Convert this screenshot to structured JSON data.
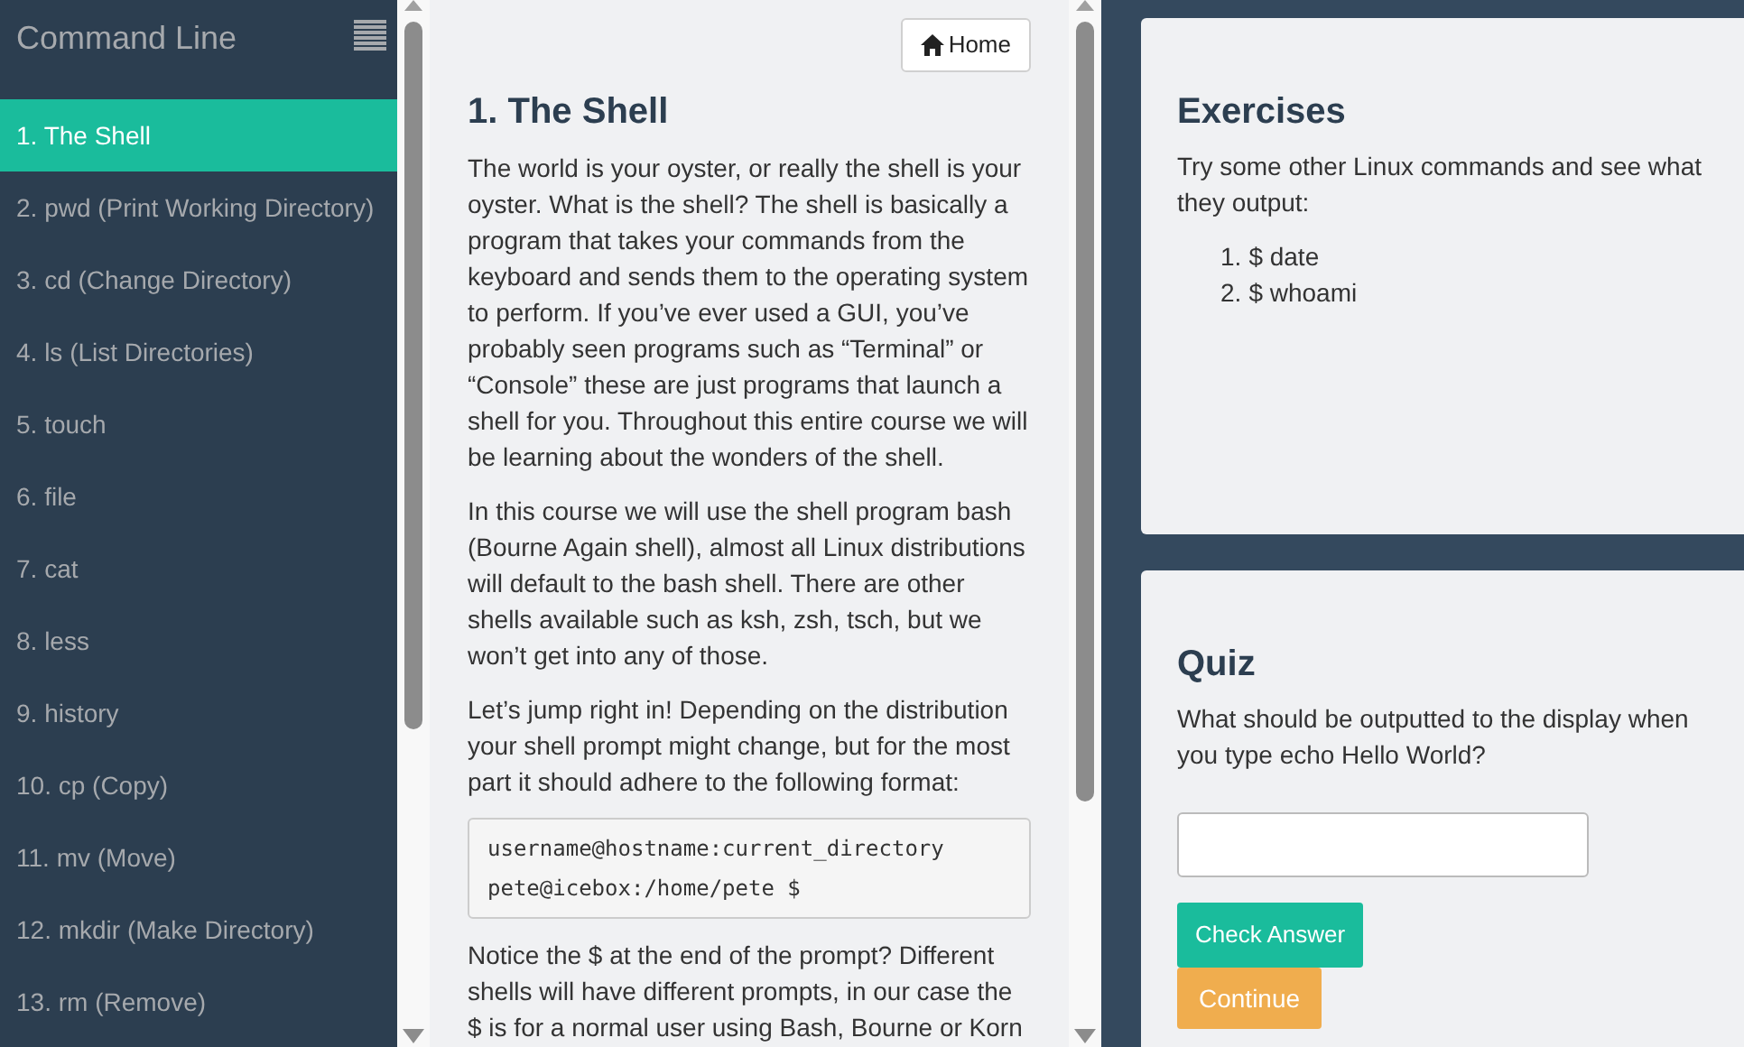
{
  "sidebar": {
    "title": "Command Line",
    "items": [
      {
        "label": "1. The Shell",
        "selected": true
      },
      {
        "label": "2. pwd (Print Working Directory)",
        "selected": false
      },
      {
        "label": "3. cd (Change Directory)",
        "selected": false
      },
      {
        "label": "4. ls (List Directories)",
        "selected": false
      },
      {
        "label": "5. touch",
        "selected": false
      },
      {
        "label": "6. file",
        "selected": false
      },
      {
        "label": "7. cat",
        "selected": false
      },
      {
        "label": "8. less",
        "selected": false
      },
      {
        "label": "9. history",
        "selected": false
      },
      {
        "label": "10. cp (Copy)",
        "selected": false
      },
      {
        "label": "11. mv (Move)",
        "selected": false
      },
      {
        "label": "12. mkdir (Make Directory)",
        "selected": false
      },
      {
        "label": "13. rm (Remove)",
        "selected": false
      }
    ]
  },
  "lesson": {
    "home_button": "Home",
    "title": "1. The Shell",
    "blocks": [
      {
        "kind": "paragraph",
        "text": "The world is your oyster, or really the shell is your oyster. What is the shell? The shell is basically a program that takes your commands from the keyboard and sends them to the operating system to perform. If you’ve ever used a GUI, you’ve probably seen programs such as “Terminal” or “Console” these are just programs that launch a shell for you. Throughout this entire course we will be learning about the wonders of the shell."
      },
      {
        "kind": "paragraph",
        "text": "In this course we will use the shell program bash (Bourne Again shell), almost all Linux distributions will default to the bash shell. There are other shells available such as ksh, zsh, tsch, but we won’t get into any of those."
      },
      {
        "kind": "paragraph",
        "text": "Let’s jump right in! Depending on the distribution your shell prompt might change, but for the most part it should adhere to the following format:"
      },
      {
        "kind": "code",
        "lines": [
          "username@hostname:current_directory",
          "pete@icebox:/home/pete $"
        ]
      },
      {
        "kind": "paragraph",
        "text": "Notice the $ at the end of the prompt? Different shells will have different prompts, in our case the $ is for a normal user using Bash, Bourne or Korn"
      }
    ]
  },
  "exercises": {
    "title": "Exercises",
    "text": "Try some other Linux commands and see what they output:",
    "items": [
      {
        "number": "1.",
        "text": "$ date"
      },
      {
        "number": "2.",
        "text": "$ whoami"
      }
    ]
  },
  "quiz": {
    "title": "Quiz",
    "question": "What should be outputted to the display when you type echo Hello World?",
    "check_button": "Check Answer",
    "continue_button": "Continue"
  }
}
